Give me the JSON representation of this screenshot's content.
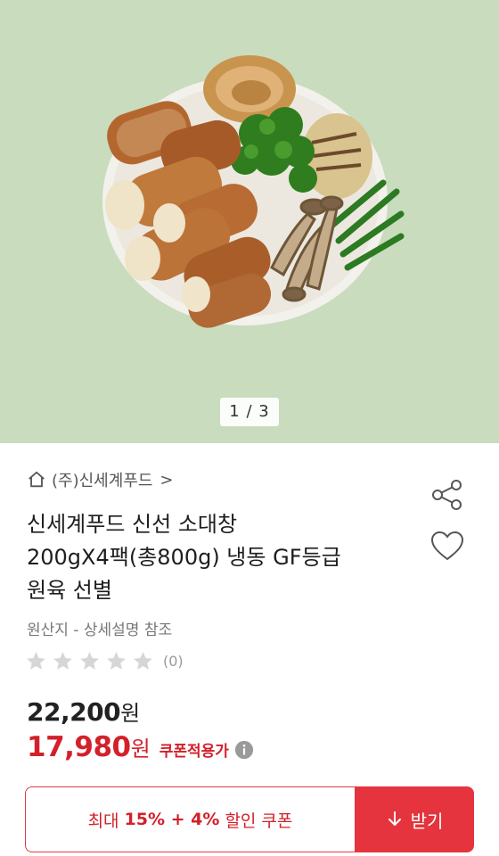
{
  "gallery": {
    "pager": "1 / 3"
  },
  "seller": {
    "name": "(주)신세계푸드",
    "chevron": ">"
  },
  "product": {
    "title_lines": [
      "신세계푸드 신선 소대창",
      "200gX4팩(총800g) 냉동 GF등급",
      "원육 선별"
    ],
    "origin": "원산지 - 상세설명 참조",
    "rating_count": "(0)",
    "stars": 0
  },
  "pricing": {
    "original_amount": "22,200",
    "original_unit": "원",
    "sale_amount": "17,980",
    "sale_unit": "원",
    "coupon_label": "쿠폰적용가"
  },
  "coupon": {
    "prefix": "최대",
    "discount": "15% + 4%",
    "suffix": "할인 쿠폰",
    "receive_label": "받기"
  },
  "colors": {
    "accent": "#e5343e",
    "sale_text": "#d3202a",
    "hero_bg": "#c9dcbd"
  }
}
